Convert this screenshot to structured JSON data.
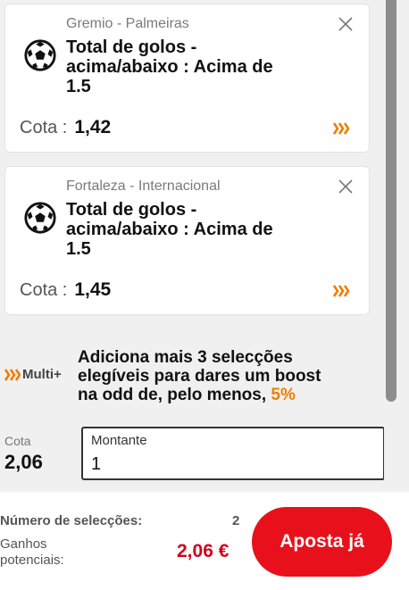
{
  "bets": [
    {
      "match": "Gremio - Palmeiras",
      "market_line1": "Total de golos -",
      "market_line2": "acima/abaixo : Acima de",
      "market_line3": "1.5",
      "odds_label": "Cota :",
      "odds_value": "1,42"
    },
    {
      "match": "Fortaleza - Internacional",
      "market_line1": "Total de golos -",
      "market_line2": "acima/abaixo : Acima de",
      "market_line3": "1.5",
      "odds_label": "Cota :",
      "odds_value": "1,45"
    }
  ],
  "multi": {
    "badge_label": "Multi+",
    "text_line1": "Adiciona mais 3 selecções",
    "text_line2": "elegíveis para dares um boost",
    "text_line3_prefix": "na odd de, pelo menos, ",
    "percent": "5%"
  },
  "total": {
    "label": "Cota",
    "value": "2,06"
  },
  "stake": {
    "label": "Montante",
    "value": "1"
  },
  "footer": {
    "selections_label": "Número de selecções:",
    "selections_value": "2",
    "gains_label_line1": "Ganhos",
    "gains_label_line2": "potenciais:",
    "gains_value": "2,06 €",
    "place_bet_label": "Aposta já"
  },
  "colors": {
    "accent_orange": "#f07d00",
    "brand_red": "#e8111b",
    "gains_red": "#d0021b"
  },
  "icons": [
    "soccer-ball-icon",
    "close-icon",
    "boost-arrows-icon"
  ]
}
